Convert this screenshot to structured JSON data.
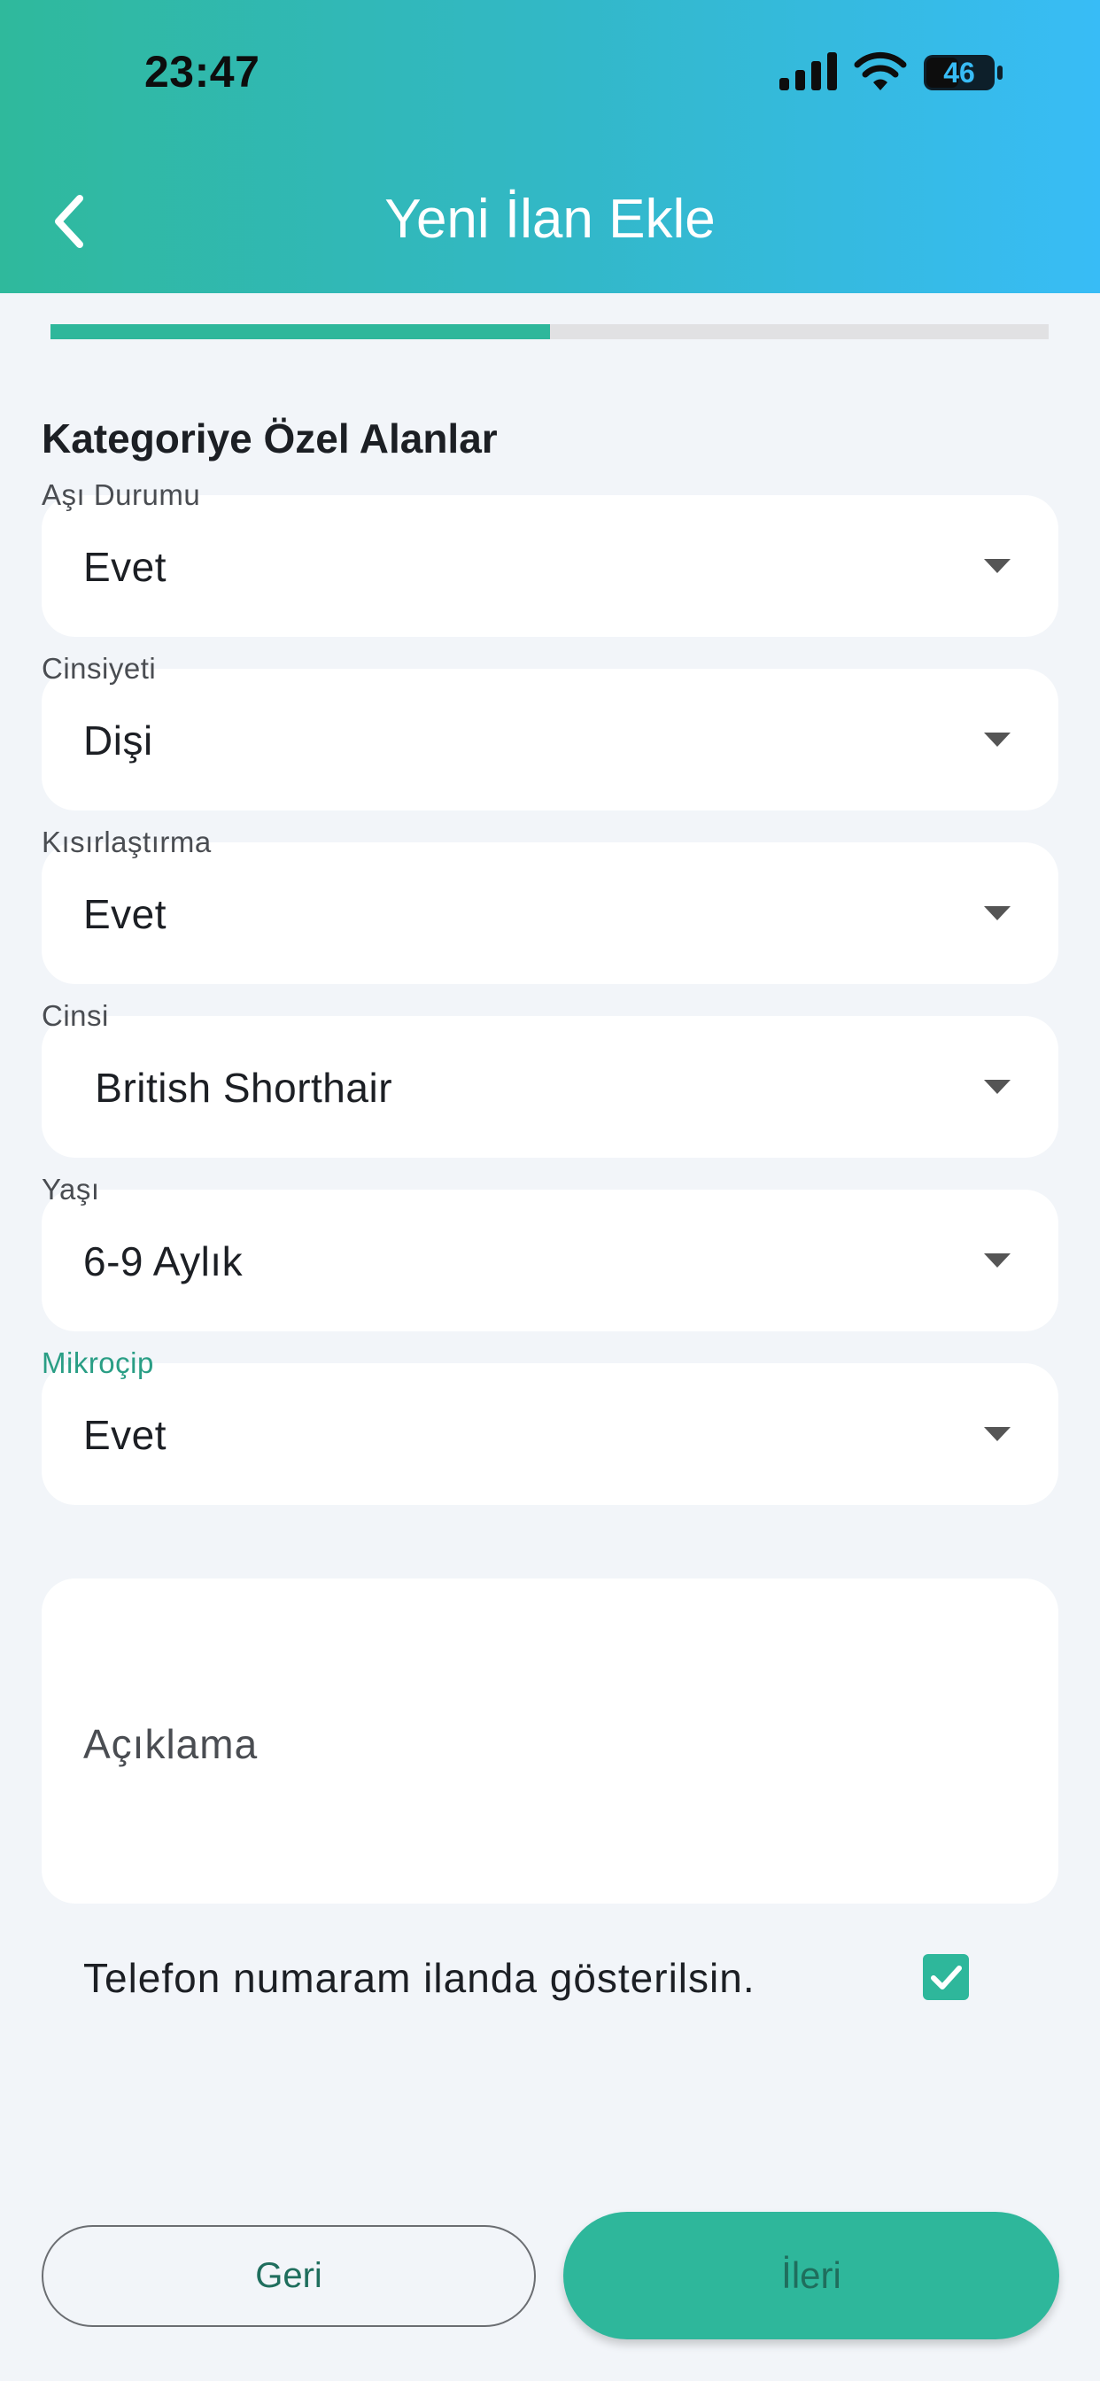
{
  "status_bar": {
    "time": "23:47",
    "battery": "46",
    "icons": [
      "signal-icon",
      "wifi-icon",
      "battery-icon"
    ]
  },
  "nav": {
    "title": "Yeni İlan Ekle",
    "back_icon": "chevron-left-icon"
  },
  "progress": {
    "fraction": 0.5
  },
  "section": {
    "title": "Kategoriye Özel Alanlar"
  },
  "fields": [
    {
      "label": "Aşı Durumu",
      "value": "Evet",
      "active": false
    },
    {
      "label": "Cinsiyeti",
      "value": "Dişi",
      "active": false
    },
    {
      "label": "Kısırlaştırma",
      "value": "Evet",
      "active": false
    },
    {
      "label": "Cinsi",
      "value": " British Shorthair",
      "active": false
    },
    {
      "label": "Yaşı",
      "value": "6-9 Aylık",
      "active": false
    },
    {
      "label": "Mikroçip",
      "value": "Evet",
      "active": true
    }
  ],
  "description": {
    "placeholder": "Açıklama"
  },
  "phone_option": {
    "label": "Telefon numaram ilanda gösterilsin.",
    "checked": true
  },
  "buttons": {
    "back": "Geri",
    "next": "İleri"
  },
  "colors": {
    "accent": "#2eb79b",
    "header_start": "#2fb99c",
    "header_end": "#38bcf6",
    "active_label": "#2a9e85",
    "background": "#f2f5f9"
  }
}
